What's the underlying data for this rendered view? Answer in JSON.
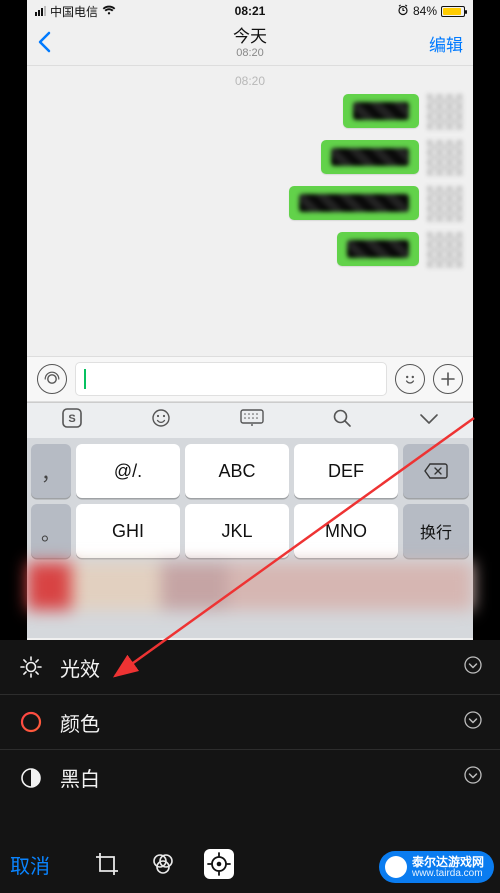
{
  "statusbar": {
    "carrier": "中国电信",
    "time": "08:21",
    "battery_pct": "84%"
  },
  "nav": {
    "title": "今天",
    "subtitle": "08:20",
    "edit": "编辑"
  },
  "chat": {
    "timestamp": "08:20"
  },
  "keyboard": {
    "row1": {
      "k1": "，",
      "k2": "@/.",
      "k3": "ABC",
      "k4": "DEF"
    },
    "row2": {
      "k1": "。",
      "k2": "GHI",
      "k3": "JKL",
      "k4": "MNO",
      "k5": "换行"
    }
  },
  "edit_panel": {
    "light": "光效",
    "color": "颜色",
    "bw": "黑白"
  },
  "bottom": {
    "cancel": "取消"
  },
  "watermark": {
    "name": "泰尔达游戏网",
    "url": "www.tairda.com"
  }
}
